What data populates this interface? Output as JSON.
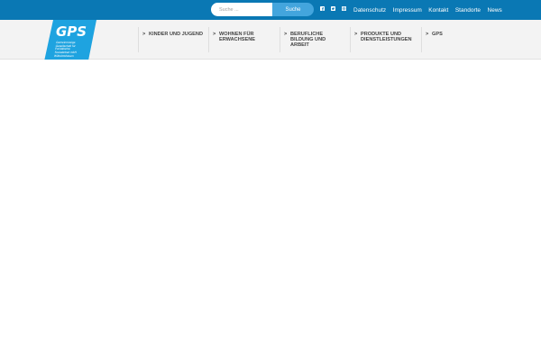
{
  "search": {
    "placeholder": "Suche ...",
    "button_label": "Suche"
  },
  "social": [
    {
      "icon": "facebook-icon"
    },
    {
      "icon": "twitter-icon"
    },
    {
      "icon": "instagram-icon"
    }
  ],
  "top_links": [
    "Datenschutz",
    "Impressum",
    "Kontakt",
    "Standorte",
    "News"
  ],
  "logo": {
    "mark": "GPS",
    "tagline": [
      "Gemeinnützige",
      "Gesellschaft für",
      "Paritätische",
      "Sozialarbeit mbH",
      "Wilhelmshaven"
    ]
  },
  "nav": {
    "arrow": ">",
    "items": [
      {
        "label": "KINDER UND JUGEND"
      },
      {
        "label": "WOHNEN FÜR ERWACHSENE"
      },
      {
        "label": "BERUFLICHE BILDUNG UND ARBEIT"
      },
      {
        "label": "PRODUKTE UND DIENSTLEISTUNGEN"
      },
      {
        "label": "GPS"
      }
    ]
  },
  "colors": {
    "topbar": "#0a78b4",
    "search_button": "#43a5dd",
    "logo_blue": "#1ea3e0",
    "nav_bg": "#f3f3f3"
  }
}
